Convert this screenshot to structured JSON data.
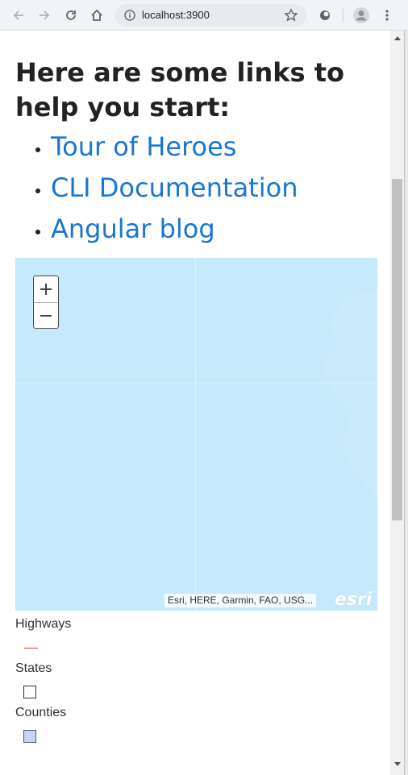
{
  "browser": {
    "url": "localhost:3900",
    "icons": [
      "back-arrow-icon",
      "forward-arrow-icon",
      "reload-icon",
      "home-icon",
      "info-icon",
      "star-icon",
      "extension-icon",
      "profile-avatar-icon",
      "kebab-menu-icon"
    ]
  },
  "page": {
    "heading": "Here are some links to help you start:",
    "links": [
      {
        "label": "Tour of Heroes"
      },
      {
        "label": "CLI Documentation"
      },
      {
        "label": "Angular blog"
      }
    ]
  },
  "map": {
    "zoom_in_label": "+",
    "zoom_out_label": "–",
    "attribution": "Esri, HERE, Garmin, FAO, USG...",
    "logo": "esri",
    "water_color": "#c6e9fb"
  },
  "legend": {
    "items": [
      {
        "label": "Highways",
        "symbol": "line",
        "color": "#e53935"
      },
      {
        "label": "States",
        "symbol": "box",
        "color": "#ffffff"
      },
      {
        "label": "Counties",
        "symbol": "box",
        "color": "#c5d4f7"
      }
    ]
  },
  "colors": {
    "link": "#1976d2",
    "toolbar": "#f1f3f4",
    "omnibox": "#e8eaed"
  }
}
